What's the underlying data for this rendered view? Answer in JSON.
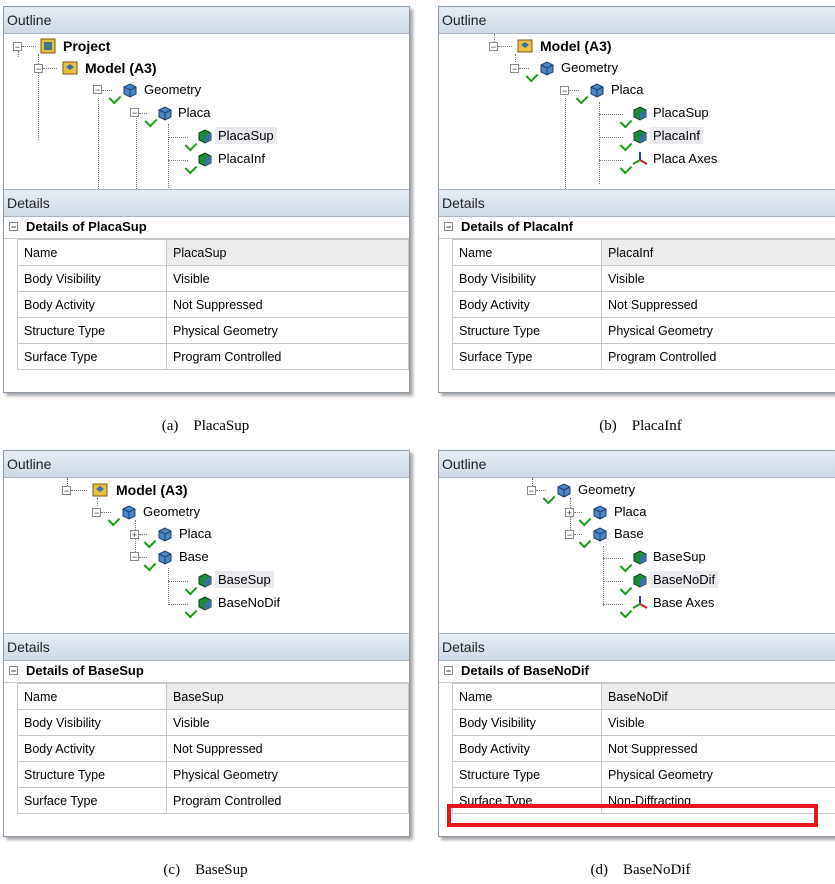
{
  "panels": {
    "a": {
      "outline_label": "Outline",
      "details_label": "Details",
      "tree": [
        {
          "label": "Project",
          "icon": "project-icon"
        },
        {
          "label": "Model (A3)",
          "icon": "model-icon"
        },
        {
          "label": "Geometry",
          "icon": "geometry-icon"
        },
        {
          "label": "Placa",
          "icon": "part-icon"
        },
        {
          "label": "PlacaSup",
          "icon": "body-icon"
        },
        {
          "label": "PlacaInf",
          "icon": "body-icon"
        }
      ],
      "details_title": "Details of PlacaSup",
      "props": [
        {
          "key": "Name",
          "value": "PlacaSup"
        },
        {
          "key": "Body Visibility",
          "value": "Visible"
        },
        {
          "key": "Body Activity",
          "value": "Not Suppressed"
        },
        {
          "key": "Structure Type",
          "value": "Physical Geometry"
        },
        {
          "key": "Surface Type",
          "value": "Program Controlled"
        }
      ],
      "caption_letter": "(a)",
      "caption_text": "PlacaSup"
    },
    "b": {
      "outline_label": "Outline",
      "details_label": "Details",
      "tree": [
        {
          "label": "Model (A3)",
          "icon": "model-icon"
        },
        {
          "label": "Geometry",
          "icon": "geometry-icon"
        },
        {
          "label": "Placa",
          "icon": "part-icon"
        },
        {
          "label": "PlacaSup",
          "icon": "body-icon"
        },
        {
          "label": "PlacaInf",
          "icon": "body-icon"
        },
        {
          "label": "Placa Axes",
          "icon": "axes-icon"
        }
      ],
      "details_title": "Details of PlacaInf",
      "props": [
        {
          "key": "Name",
          "value": "PlacaInf"
        },
        {
          "key": "Body Visibility",
          "value": "Visible"
        },
        {
          "key": "Body Activity",
          "value": "Not Suppressed"
        },
        {
          "key": "Structure Type",
          "value": "Physical Geometry"
        },
        {
          "key": "Surface Type",
          "value": "Program Controlled"
        }
      ],
      "caption_letter": "(b)",
      "caption_text": "PlacaInf"
    },
    "c": {
      "outline_label": "Outline",
      "details_label": "Details",
      "tree": [
        {
          "label": "Model (A3)",
          "icon": "model-icon"
        },
        {
          "label": "Geometry",
          "icon": "geometry-icon"
        },
        {
          "label": "Placa",
          "icon": "part-icon"
        },
        {
          "label": "Base",
          "icon": "part-icon"
        },
        {
          "label": "BaseSup",
          "icon": "body-icon"
        },
        {
          "label": "BaseNoDif",
          "icon": "body-icon"
        }
      ],
      "details_title": "Details of BaseSup",
      "props": [
        {
          "key": "Name",
          "value": "BaseSup"
        },
        {
          "key": "Body Visibility",
          "value": "Visible"
        },
        {
          "key": "Body Activity",
          "value": "Not Suppressed"
        },
        {
          "key": "Structure Type",
          "value": "Physical Geometry"
        },
        {
          "key": "Surface Type",
          "value": "Program Controlled"
        }
      ],
      "caption_letter": "(c)",
      "caption_text": "BaseSup"
    },
    "d": {
      "outline_label": "Outline",
      "details_label": "Details",
      "tree": [
        {
          "label": "Geometry",
          "icon": "geometry-icon"
        },
        {
          "label": "Placa",
          "icon": "part-icon"
        },
        {
          "label": "Base",
          "icon": "part-icon"
        },
        {
          "label": "BaseSup",
          "icon": "body-icon"
        },
        {
          "label": "BaseNoDif",
          "icon": "body-icon"
        },
        {
          "label": "Base Axes",
          "icon": "axes-icon"
        }
      ],
      "details_title": "Details of BaseNoDif",
      "props": [
        {
          "key": "Name",
          "value": "BaseNoDif"
        },
        {
          "key": "Body Visibility",
          "value": "Visible"
        },
        {
          "key": "Body Activity",
          "value": "Not Suppressed"
        },
        {
          "key": "Structure Type",
          "value": "Physical Geometry"
        },
        {
          "key": "Surface Type",
          "value": "Non-Diffracting"
        }
      ],
      "caption_letter": "(d)",
      "caption_text": "BaseNoDif"
    }
  },
  "colors": {
    "highlight": "#e8141c",
    "check": "#1c9a1c",
    "header": "#cfdae6"
  }
}
